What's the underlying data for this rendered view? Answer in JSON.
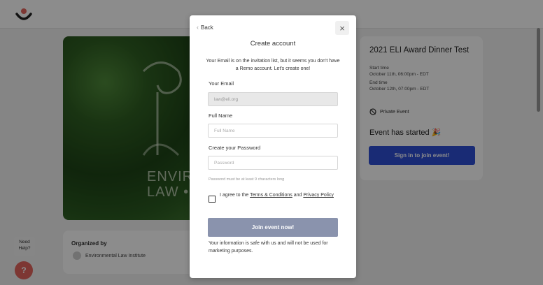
{
  "background": {
    "event_image_text": "ENVIR\nLAW •",
    "organizer": {
      "title": "Organized by",
      "name": "Environmental Law Institute"
    },
    "event": {
      "title": "2021 ELI Award Dinner Test",
      "start_label": "Start time",
      "start_value": "October 11th, 06:00pm - EDT",
      "end_label": "End time",
      "end_value": "October 12th, 07:00pm - EDT",
      "private_label": "Private Event",
      "started_label": "Event has started",
      "sign_in_label": "Sign in to join event!"
    },
    "help": {
      "text": "Need Help?",
      "button_glyph": "?"
    }
  },
  "modal": {
    "back_label": "Back",
    "close_glyph": "×",
    "title": "Create account",
    "description": "Your Email is on the invitation list, but it seems you don't have a Remo account. Let's create one!",
    "email_label": "Your Email",
    "email_value": "law@eli.org",
    "fullname_label": "Full Name",
    "fullname_placeholder": "Full Name",
    "password_label": "Create your Password",
    "password_placeholder": "Password",
    "password_hint": "Password must be at least 9 characters long",
    "agree_prefix": "I agree to the ",
    "terms_label": "Terms & Conditions",
    "agree_and": " and ",
    "privacy_label": "Privacy Policy",
    "join_label": "Join event now!",
    "safe_text": "Your information is safe with us and will not be used for marketing purposes."
  },
  "colors": {
    "brand_red": "#e3655d",
    "primary_blue": "#2f4fd6",
    "join_disabled": "#8a93ad"
  }
}
